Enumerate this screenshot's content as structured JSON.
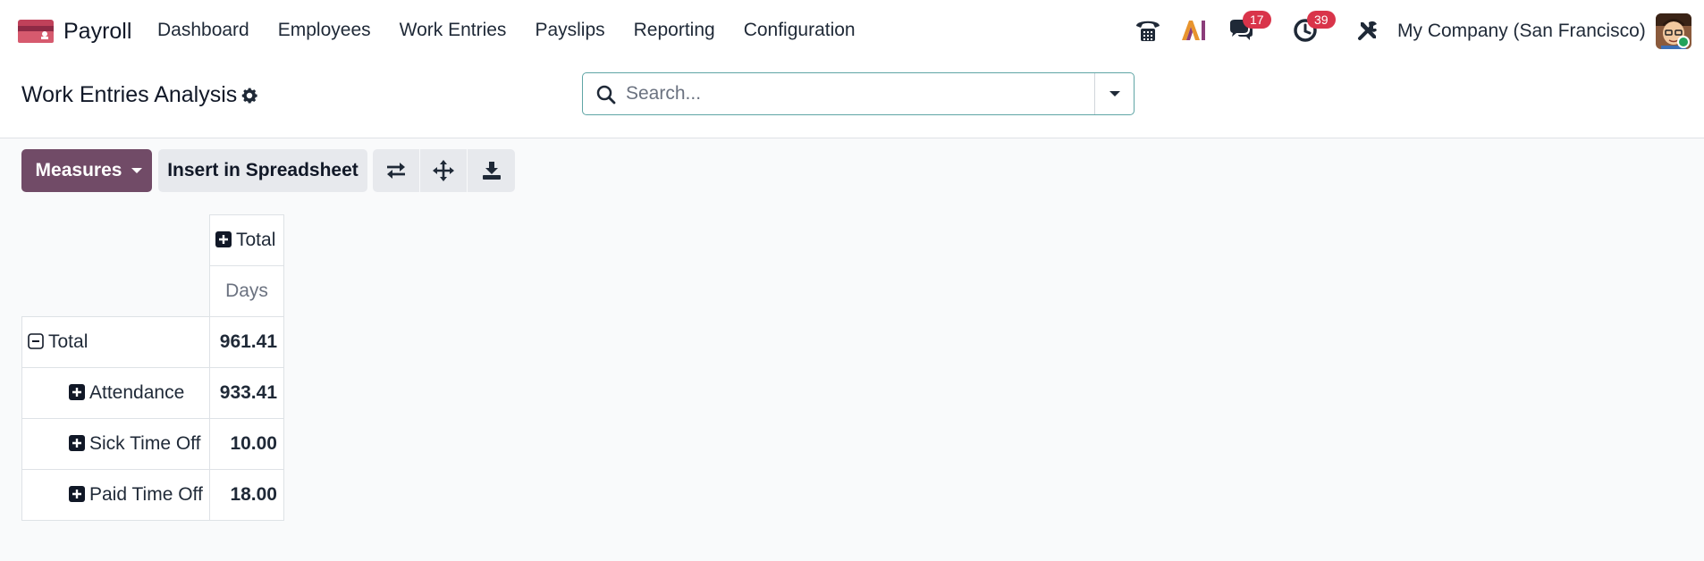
{
  "app": {
    "name": "Payroll",
    "logo_icon": "payroll-logo-icon",
    "accent": "#714b67"
  },
  "nav": {
    "items": [
      {
        "label": "Dashboard"
      },
      {
        "label": "Employees"
      },
      {
        "label": "Work Entries"
      },
      {
        "label": "Payslips"
      },
      {
        "label": "Reporting"
      },
      {
        "label": "Configuration"
      }
    ]
  },
  "systray": {
    "phone_icon": "phone-icon",
    "ai_label": "AI",
    "messages_count": "17",
    "activities_count": "39",
    "tools_icon": "tools-icon",
    "company": "My Company (San Francisco)",
    "badge_color": "#d9344a"
  },
  "control_panel": {
    "title": "Work Entries Analysis",
    "search_placeholder": "Search..."
  },
  "toolbar": {
    "measures_label": "Measures",
    "insert_label": "Insert in Spreadsheet",
    "icons": [
      "flip-axis-icon",
      "expand-all-icon",
      "download-icon"
    ]
  },
  "pivot": {
    "col_header": "Total",
    "measure": "Days",
    "rows": [
      {
        "label": "Total",
        "value": "961.41",
        "level": 0,
        "expanded": true
      },
      {
        "label": "Attendance",
        "value": "933.41",
        "level": 1,
        "expanded": false
      },
      {
        "label": "Sick Time Off",
        "value": "10.00",
        "level": 1,
        "expanded": false
      },
      {
        "label": "Paid Time Off",
        "value": "18.00",
        "level": 1,
        "expanded": false
      }
    ]
  }
}
